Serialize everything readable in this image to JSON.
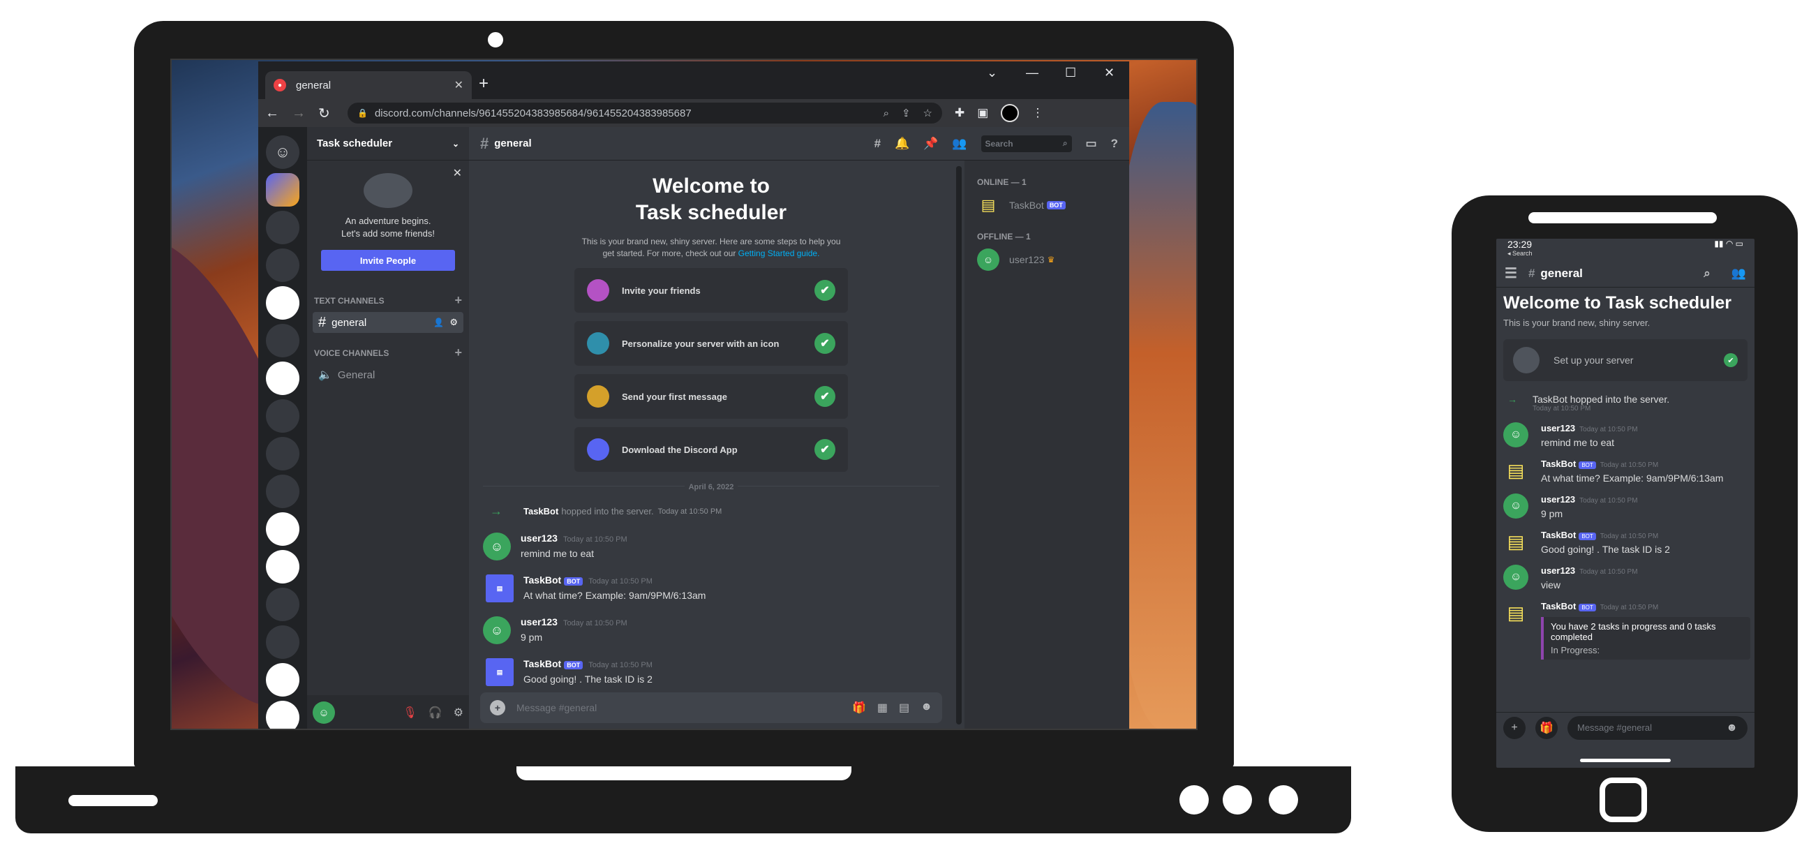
{
  "browser": {
    "tab_title": "general",
    "url": "discord.com/channels/961455204383985684/961455204383985687"
  },
  "server": {
    "name": "Task scheduler",
    "invite_line1": "An adventure begins.",
    "invite_line2": "Let's add some friends!",
    "invite_button": "Invite People",
    "text_category": "TEXT CHANNELS",
    "voice_category": "VOICE CHANNELS",
    "text_channel": "general",
    "voice_channel": "General"
  },
  "channel": {
    "name": "general",
    "search_placeholder": "Search",
    "welcome_line1": "Welcome to",
    "welcome_line2": "Task scheduler",
    "sub_text": "This is your brand new, shiny server. Here are some steps to help you get started. For more, check out our",
    "sub_link": "Getting Started guide.",
    "steps": [
      {
        "label": "Invite your friends",
        "color": "#b452c4"
      },
      {
        "label": "Personalize your server with an icon",
        "color": "#2f8fab"
      },
      {
        "label": "Send your first message",
        "color": "#d4a02a"
      },
      {
        "label": "Download the Discord App",
        "color": "#5865f2"
      }
    ],
    "date_divider": "April 6, 2022",
    "join_name": "TaskBot",
    "join_text": "hopped into the server.",
    "join_time": "Today at 10:50 PM",
    "messages": [
      {
        "author": "user123",
        "bot": false,
        "time": "Today at 10:50 PM",
        "text": "remind me to eat"
      },
      {
        "author": "TaskBot",
        "bot": true,
        "time": "Today at 10:50 PM",
        "text": "At what time? Example: 9am/9PM/6:13am"
      },
      {
        "author": "user123",
        "bot": false,
        "time": "Today at 10:50 PM",
        "text": "9 pm"
      },
      {
        "author": "TaskBot",
        "bot": true,
        "time": "Today at 10:50 PM",
        "text": "Good going! . The task ID is 2"
      }
    ],
    "composer_placeholder": "Message #general",
    "bot_tag": "BOT"
  },
  "members": {
    "online_header": "ONLINE — 1",
    "offline_header": "OFFLINE — 1",
    "online_member": "TaskBot",
    "offline_member": "user123"
  },
  "phone": {
    "time": "23:29",
    "back_label": "◂ Search",
    "channel": "general",
    "welcome": "Welcome to Task scheduler",
    "sub": "This is your brand new, shiny server.",
    "setup": "Set up your server",
    "join_text": "TaskBot hopped into the server.",
    "join_time": "Today at 10:50 PM",
    "messages": [
      {
        "author": "user123",
        "bot": false,
        "time": "Today at 10:50 PM",
        "text": "remind me to eat"
      },
      {
        "author": "TaskBot",
        "bot": true,
        "time": "Today at 10:50 PM",
        "text": "At what time? Example: 9am/9PM/6:13am"
      },
      {
        "author": "user123",
        "bot": false,
        "time": "Today at 10:50 PM",
        "text": "9 pm"
      },
      {
        "author": "TaskBot",
        "bot": true,
        "time": "Today at 10:50 PM",
        "text": "Good going! . The task ID is 2"
      },
      {
        "author": "user123",
        "bot": false,
        "time": "Today at 10:50 PM",
        "text": "view"
      }
    ],
    "last_author": "TaskBot",
    "last_time": "Today at 10:50 PM",
    "embed_text": "You have 2 tasks in progress and 0 tasks completed",
    "embed_sub": "In Progress:",
    "composer_placeholder": "Message #general"
  }
}
